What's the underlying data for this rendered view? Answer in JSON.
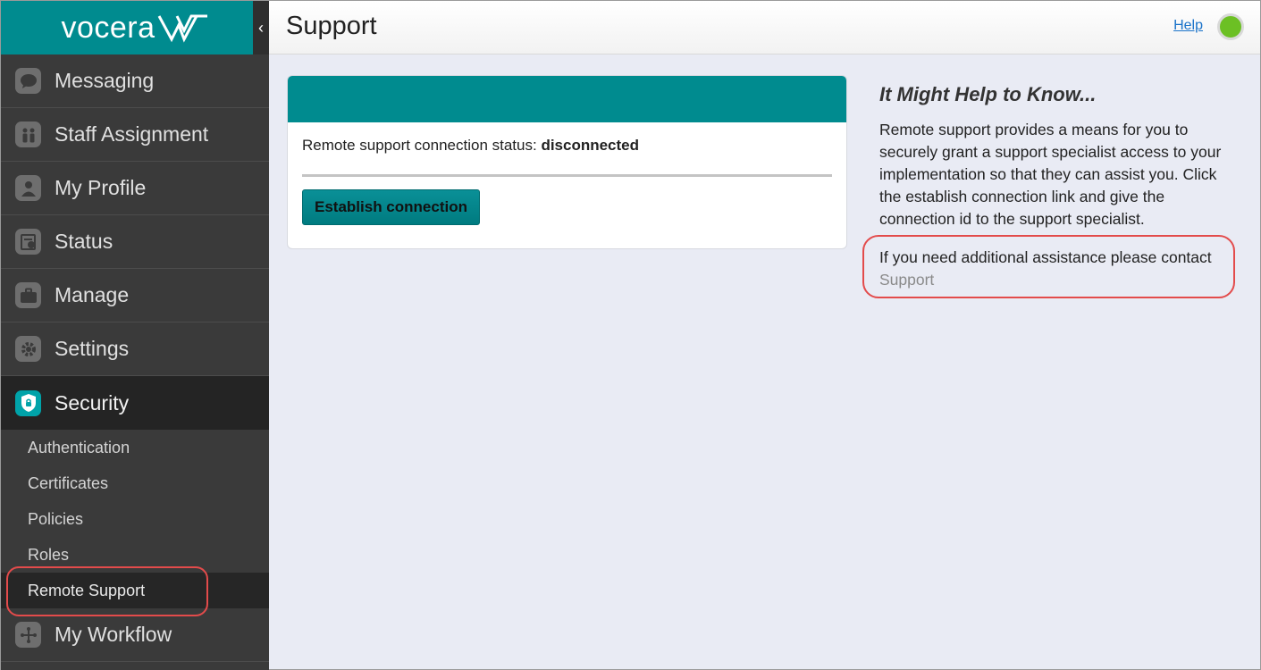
{
  "brand": {
    "name": "vocera"
  },
  "sidebar": {
    "collapse_glyph": "‹",
    "items": [
      {
        "label": "Messaging",
        "icon": "chat-bubble-icon"
      },
      {
        "label": "Staff Assignment",
        "icon": "people-icon"
      },
      {
        "label": "My Profile",
        "icon": "person-icon"
      },
      {
        "label": "Status",
        "icon": "status-chart-icon"
      },
      {
        "label": "Manage",
        "icon": "briefcase-icon"
      },
      {
        "label": "Settings",
        "icon": "gear-icon"
      },
      {
        "label": "Security",
        "icon": "shield-icon",
        "active": true
      }
    ],
    "security_sub": [
      {
        "label": "Authentication"
      },
      {
        "label": "Certificates"
      },
      {
        "label": "Policies"
      },
      {
        "label": "Roles"
      },
      {
        "label": "Remote Support",
        "active": true
      }
    ],
    "after": [
      {
        "label": "My Workflow",
        "icon": "workflow-icon"
      }
    ]
  },
  "header": {
    "title": "Support",
    "help_label": "Help",
    "status_color": "#6cc024"
  },
  "card": {
    "status_prefix": "Remote support connection status:",
    "status_value": "disconnected",
    "button_label": "Establish connection"
  },
  "info": {
    "title": "It Might Help to Know...",
    "body": "Remote support provides a means for you to securely grant a support specialist access to your implementation so that they can assist you. Click the establish connection link and give the connection id to the support specialist.",
    "contact_text": "If you need additional assistance please contact",
    "contact_link": "Support"
  },
  "colors": {
    "accent": "#008b8f",
    "sidebar": "#3a3a3a",
    "highlight": "#e34b4b"
  }
}
